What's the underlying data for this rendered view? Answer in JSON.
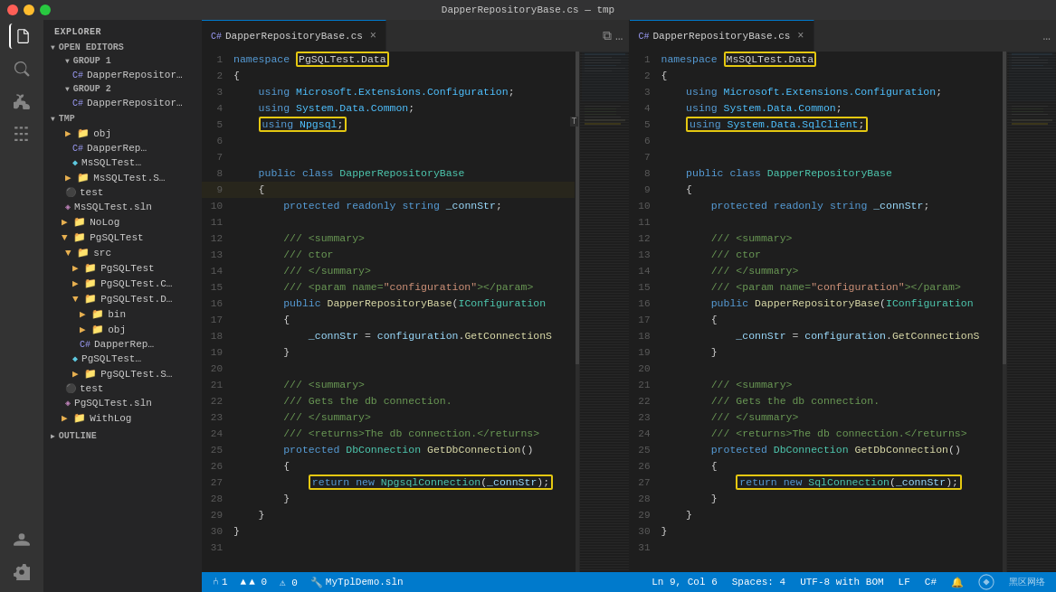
{
  "titleBar": {
    "title": "DapperRepositoryBase.cs — tmp"
  },
  "sidebar": {
    "header": "EXPLORER",
    "openEditors": "OPEN EDITORS",
    "group1": "GROUP 1",
    "group2": "GROUP 2",
    "tmp": "TMP",
    "outline": "OUTLINE",
    "items": [
      {
        "id": "g1-dapper",
        "label": "DapperRepositor…",
        "icon": "cs",
        "indent": 1
      },
      {
        "id": "g2-dapper",
        "label": "DapperRepositor…",
        "icon": "cs",
        "indent": 1
      },
      {
        "id": "tmp-folder",
        "label": "tmp",
        "icon": "folder",
        "indent": 0
      },
      {
        "id": "obj",
        "label": "obj",
        "icon": "folder",
        "indent": 1
      },
      {
        "id": "dapperrep",
        "label": "DapperRep…",
        "icon": "cs",
        "indent": 2
      },
      {
        "id": "mssqltest",
        "label": "MsSQLTest…",
        "icon": "nuget",
        "indent": 2
      },
      {
        "id": "mssqltests",
        "label": "MsSQLTest.S…",
        "icon": "folder",
        "indent": 1
      },
      {
        "id": "test",
        "label": "test",
        "icon": "test",
        "indent": 1
      },
      {
        "id": "mssqlsln",
        "label": "MsSQLTest.sln",
        "icon": "sln",
        "indent": 1
      },
      {
        "id": "nolog",
        "label": "NoLog",
        "icon": "folder",
        "indent": 0
      },
      {
        "id": "pgsqltest",
        "label": "PgSQLTest",
        "icon": "folder",
        "indent": 0
      },
      {
        "id": "src",
        "label": "src",
        "icon": "folder",
        "indent": 1
      },
      {
        "id": "pgsqltestf",
        "label": "PgSQLTest",
        "icon": "folder",
        "indent": 2
      },
      {
        "id": "pgsqltestc",
        "label": "PgSQLTest.C…",
        "icon": "folder",
        "indent": 2
      },
      {
        "id": "pgsqltestd",
        "label": "PgSQLTest.D…",
        "icon": "folder",
        "indent": 2
      },
      {
        "id": "bin",
        "label": "bin",
        "icon": "folder",
        "indent": 3
      },
      {
        "id": "obj2",
        "label": "obj",
        "icon": "folder",
        "indent": 3
      },
      {
        "id": "dapperrep2",
        "label": "DapperRep…",
        "icon": "cs",
        "indent": 4
      },
      {
        "id": "pgsqltestnuget",
        "label": "PgSQLTest…",
        "icon": "nuget",
        "indent": 3
      },
      {
        "id": "pgsqltests",
        "label": "PgSQLTest.S…",
        "icon": "folder",
        "indent": 2
      },
      {
        "id": "test2",
        "label": "test",
        "icon": "test",
        "indent": 1
      },
      {
        "id": "pgsqlsln",
        "label": "PgSQLTest.sln",
        "icon": "sln",
        "indent": 1
      },
      {
        "id": "withlog",
        "label": "WithLog",
        "icon": "folder",
        "indent": 0
      }
    ]
  },
  "leftEditor": {
    "tabName": "DapperRepositoryBase.cs",
    "namespace": "PgSQLTest.Data",
    "usingHighlight": "using Npgsql;",
    "returnHighlight": "return new NpgsqlConnection(_connStr);",
    "lines": [
      {
        "n": 1,
        "text": "namespace PgSQLTest.Data"
      },
      {
        "n": 2,
        "text": "{"
      },
      {
        "n": 3,
        "text": "    using Microsoft.Extensions.Configuration;"
      },
      {
        "n": 4,
        "text": "    using System.Data.Common;"
      },
      {
        "n": 5,
        "text": "    using Npgsql;"
      },
      {
        "n": 6,
        "text": ""
      },
      {
        "n": 7,
        "text": ""
      },
      {
        "n": 8,
        "text": "    public class DapperRepositoryBase"
      },
      {
        "n": 9,
        "text": "    {"
      },
      {
        "n": 10,
        "text": "        protected readonly string _connStr;"
      },
      {
        "n": 11,
        "text": ""
      },
      {
        "n": 12,
        "text": "        /// <summary>"
      },
      {
        "n": 13,
        "text": "        /// ctor"
      },
      {
        "n": 14,
        "text": "        /// </summary>"
      },
      {
        "n": 15,
        "text": "        /// <param name=\"configuration\"></param>"
      },
      {
        "n": 16,
        "text": "        public DapperRepositoryBase(IConfiguration"
      },
      {
        "n": 17,
        "text": "        {"
      },
      {
        "n": 18,
        "text": "            _connStr = configuration.GetConnectionS"
      },
      {
        "n": 19,
        "text": "        }"
      },
      {
        "n": 20,
        "text": ""
      },
      {
        "n": 21,
        "text": "        /// <summary>"
      },
      {
        "n": 22,
        "text": "        /// Gets the db connection."
      },
      {
        "n": 23,
        "text": "        /// </summary>"
      },
      {
        "n": 24,
        "text": "        /// <returns>The db connection.</returns>"
      },
      {
        "n": 25,
        "text": "        protected DbConnection GetDbConnection()"
      },
      {
        "n": 26,
        "text": "        {"
      },
      {
        "n": 27,
        "text": "            return new NpgsqlConnection(_connStr);"
      },
      {
        "n": 28,
        "text": "        }"
      },
      {
        "n": 29,
        "text": "    }"
      },
      {
        "n": 30,
        "text": "}"
      },
      {
        "n": 31,
        "text": ""
      }
    ]
  },
  "rightEditor": {
    "tabName": "DapperRepositoryBase.cs",
    "namespace": "MsSQLTest.Data",
    "usingHighlight": "using System.Data.SqlClient;",
    "returnHighlight": "return new SqlConnection(_connStr);",
    "lines": [
      {
        "n": 1,
        "text": "namespace MsSQLTest.Data"
      },
      {
        "n": 2,
        "text": "{"
      },
      {
        "n": 3,
        "text": "    using Microsoft.Extensions.Configuration;"
      },
      {
        "n": 4,
        "text": "    using System.Data.Common;"
      },
      {
        "n": 5,
        "text": "    using System.Data.SqlClient;"
      },
      {
        "n": 6,
        "text": ""
      },
      {
        "n": 7,
        "text": ""
      },
      {
        "n": 8,
        "text": "    public class DapperRepositoryBase"
      },
      {
        "n": 9,
        "text": "    {"
      },
      {
        "n": 10,
        "text": "        protected readonly string _connStr;"
      },
      {
        "n": 11,
        "text": ""
      },
      {
        "n": 12,
        "text": "        /// <summary>"
      },
      {
        "n": 13,
        "text": "        /// ctor"
      },
      {
        "n": 14,
        "text": "        /// </summary>"
      },
      {
        "n": 15,
        "text": "        /// <param name=\"configuration\"></param>"
      },
      {
        "n": 16,
        "text": "        public DapperRepositoryBase(IConfiguration"
      },
      {
        "n": 17,
        "text": "        {"
      },
      {
        "n": 18,
        "text": "            _connStr = configuration.GetConnectionS"
      },
      {
        "n": 19,
        "text": "        }"
      },
      {
        "n": 20,
        "text": ""
      },
      {
        "n": 21,
        "text": "        /// <summary>"
      },
      {
        "n": 22,
        "text": "        /// Gets the db connection."
      },
      {
        "n": 23,
        "text": "        /// </summary>"
      },
      {
        "n": 24,
        "text": "        /// <returns>The db connection.</returns>"
      },
      {
        "n": 25,
        "text": "        protected DbConnection GetDbConnection()"
      },
      {
        "n": 26,
        "text": "        {"
      },
      {
        "n": 27,
        "text": "            return new SqlConnection(_connStr);"
      },
      {
        "n": 28,
        "text": "        }"
      },
      {
        "n": 29,
        "text": "    }"
      },
      {
        "n": 30,
        "text": "}"
      },
      {
        "n": 31,
        "text": ""
      }
    ]
  },
  "statusBar": {
    "git": "⑃ 1",
    "errors": "▲ 0",
    "warnings": "⚠ 0",
    "position": "Ln 9, Col 6",
    "spaces": "Spaces: 4",
    "encoding": "UTF-8 with BOM",
    "lineEnding": "LF",
    "language": "C#",
    "feedback": "🔔",
    "bottomFile": "MyTplDemo.sln"
  }
}
